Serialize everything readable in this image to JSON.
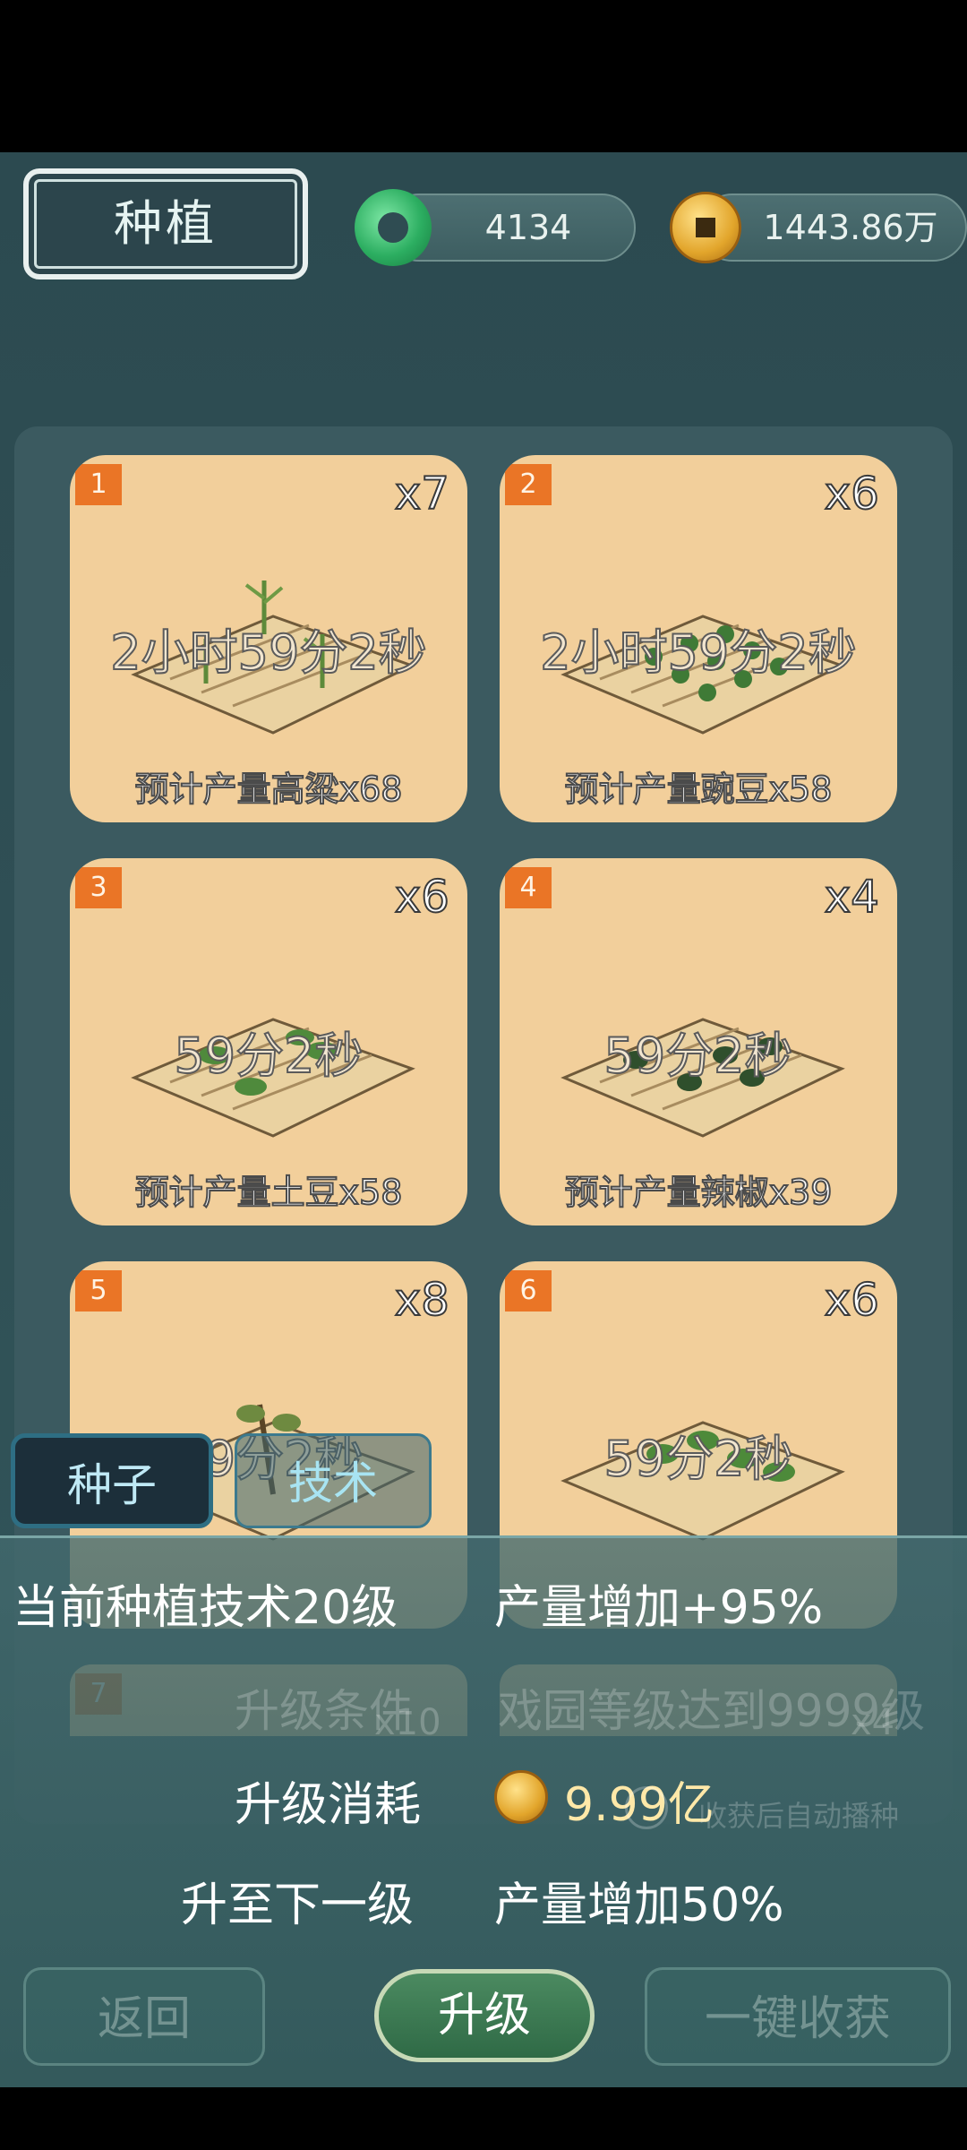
{
  "header": {
    "title": "种植",
    "jade_amount": "4134",
    "coin_amount": "1443.86万"
  },
  "plots": [
    {
      "number": "1",
      "count": "x7",
      "timer": "2小时59分2秒",
      "yield": "预计产量高粱x68"
    },
    {
      "number": "2",
      "count": "x6",
      "timer": "2小时59分2秒",
      "yield": "预计产量豌豆x58"
    },
    {
      "number": "3",
      "count": "x6",
      "timer": "59分2秒",
      "yield": "预计产量土豆x58"
    },
    {
      "number": "4",
      "count": "x4",
      "timer": "59分2秒",
      "yield": "预计产量辣椒x39"
    },
    {
      "number": "5",
      "count": "x8",
      "timer": "59分2秒",
      "yield": ""
    },
    {
      "number": "6",
      "count": "x6",
      "timer": "59分2秒",
      "yield": ""
    }
  ],
  "behind_overlay": {
    "plot7_number": "7",
    "plot7_count": "x10",
    "plot8_count": "x4",
    "auto_replant": "收获后自动播种"
  },
  "tabs": {
    "seeds": "种子",
    "tech": "技术"
  },
  "tech_panel": {
    "current_label": "当前种植技术20级",
    "current_effect": "产量增加+95%",
    "condition_label": "升级条件",
    "condition_value": "戏园等级达到9999级",
    "cost_label": "升级消耗",
    "cost_value": "9.99亿",
    "next_label": "升至下一级",
    "next_effect": "产量增加50%"
  },
  "buttons": {
    "back": "返回",
    "upgrade": "升级",
    "harvest_all": "一键收获"
  },
  "colors": {
    "background": "#2f4f55",
    "card": "#f2cf9b",
    "badge": "#ea7526"
  }
}
